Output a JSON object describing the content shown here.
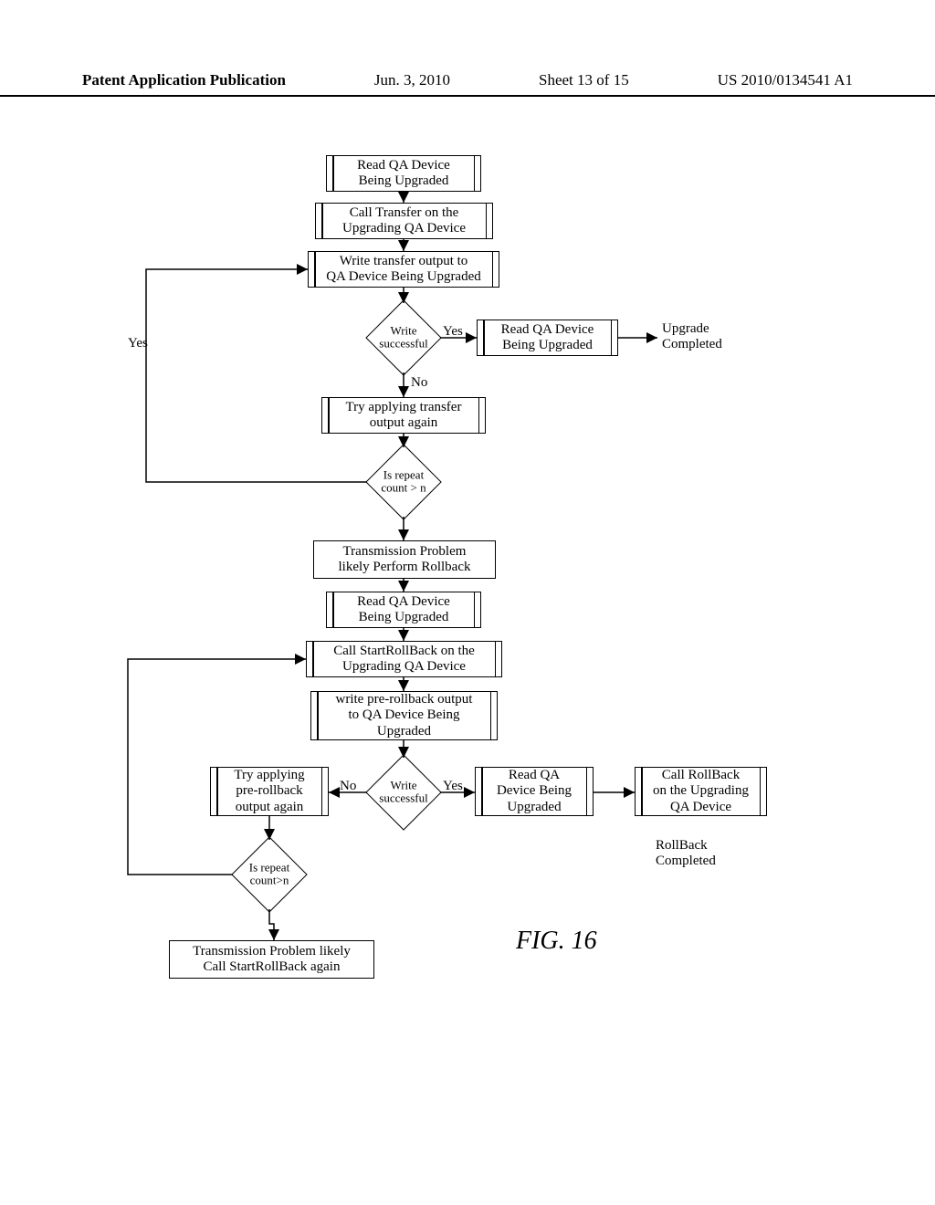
{
  "header": {
    "publication": "Patent Application Publication",
    "date": "Jun. 3, 2010",
    "sheet": "Sheet 13 of 15",
    "docnum": "US 2010/0134541 A1"
  },
  "labels": {
    "yes": "Yes",
    "no": "No",
    "upgrade_completed": "Upgrade\nCompleted",
    "rollback_completed": "RollBack\nCompleted",
    "fig": "FIG. 16"
  },
  "nodes": {
    "n1": "Read QA Device\nBeing Upgraded",
    "n2": "Call Transfer on the\nUpgrading QA Device",
    "n3": "Write transfer output to\nQA Device Being Upgraded",
    "d1": "Write\nsuccessful",
    "n4": "Read QA Device\nBeing Upgraded",
    "n5": "Try applying transfer\noutput again",
    "d2": "Is repeat\ncount > n",
    "n6": "Transmission Problem\nlikely Perform Rollback",
    "n7": "Read QA Device\nBeing Upgraded",
    "n8": "Call StartRollBack on the\nUpgrading QA Device",
    "n9": "write pre-rollback output\nto QA Device Being\nUpgraded",
    "d3": "Write\nsuccessful",
    "n10": "Read QA\nDevice Being\nUpgraded",
    "n11": "Call RollBack\non the Upgrading\nQA Device",
    "n12": "Try applying\npre-rollback\noutput again",
    "d4": "Is repeat\ncount>n",
    "n13": "Transmission Problem likely\nCall StartRollBack again"
  }
}
